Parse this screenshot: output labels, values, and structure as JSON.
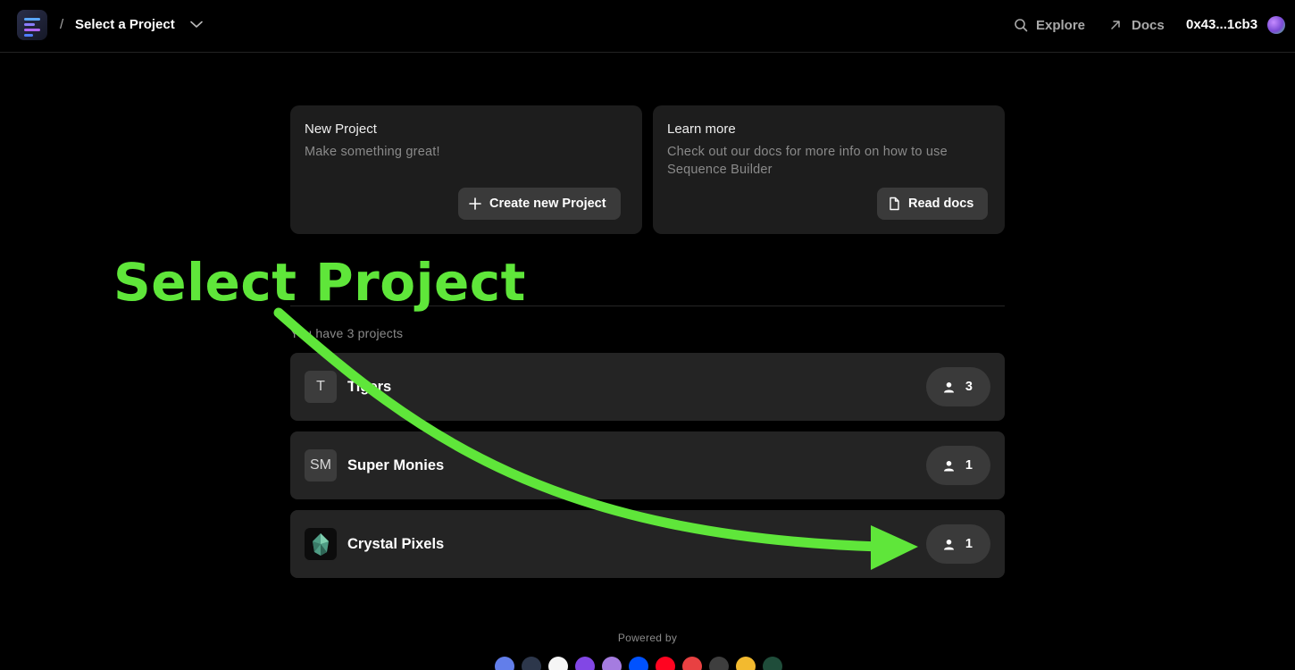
{
  "header": {
    "breadcrumb_sep": "/",
    "title": "Select a Project",
    "explore_label": "Explore",
    "docs_label": "Docs",
    "wallet_address": "0x43...1cb3"
  },
  "cards": {
    "new_project": {
      "title": "New Project",
      "description": "Make something great!",
      "button_label": "Create new Project",
      "button_icon": "plus-icon"
    },
    "learn_more": {
      "title": "Learn more",
      "description": "Check out our docs for more info on how to use Sequence Builder",
      "button_label": "Read docs",
      "button_icon": "document-icon"
    }
  },
  "projects_count_text": "You have 3 projects",
  "projects": [
    {
      "avatar": "T",
      "name": "Tigers",
      "members": "3"
    },
    {
      "avatar": "SM",
      "name": "Super Monies",
      "members": "1"
    },
    {
      "avatar": "",
      "name": "Crystal Pixels",
      "members": "1"
    }
  ],
  "annotation": {
    "text": "Select Project",
    "color": "#5fe63a"
  },
  "footer": {
    "powered_by": "Powered by",
    "chain_icons": [
      "ethereum-icon",
      "arbitrum-icon",
      "arbitrum-nova-icon",
      "polygon-icon",
      "polygon-zkevm-icon",
      "base-icon",
      "optimism-icon",
      "avalanche-icon",
      "gnosis-icon",
      "bnb-icon",
      "xai-icon"
    ]
  },
  "colors": {
    "background": "#000000",
    "card": "#1d1d1d",
    "row": "#242424",
    "accent_green": "#5fe63a"
  }
}
